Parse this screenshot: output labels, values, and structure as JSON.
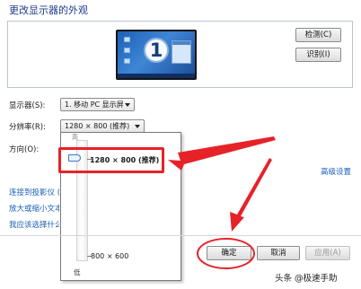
{
  "window": {
    "title": "更改显示器的外观"
  },
  "preview": {
    "monitor_number": "1"
  },
  "buttons": {
    "detect": "检测(C)",
    "identify": "识别(I)",
    "ok": "确定",
    "cancel": "取消",
    "apply": "应用(A)"
  },
  "settings": {
    "display": {
      "label": "显示器(S):",
      "value": "1. 移动 PC 显示屏"
    },
    "resolution": {
      "label": "分辨率(R):",
      "value": "1280 × 800 (推荐)"
    },
    "orientation": {
      "label": "方向(O):"
    }
  },
  "resolution_dropdown": {
    "high_label": "高",
    "low_label": "低",
    "top_option": "1280 × 800 (推荐)",
    "bottom_option": "800 × 600",
    "selected_fraction": 0.0
  },
  "links": {
    "advanced": "高级设置",
    "projector": "连接到投影仪 (",
    "text_size": "放大或缩小文本",
    "help": "我应该选择什么"
  },
  "watermark": {
    "text": "头条 @极速手助"
  },
  "annotation_colors": {
    "highlight": "#e62228"
  }
}
